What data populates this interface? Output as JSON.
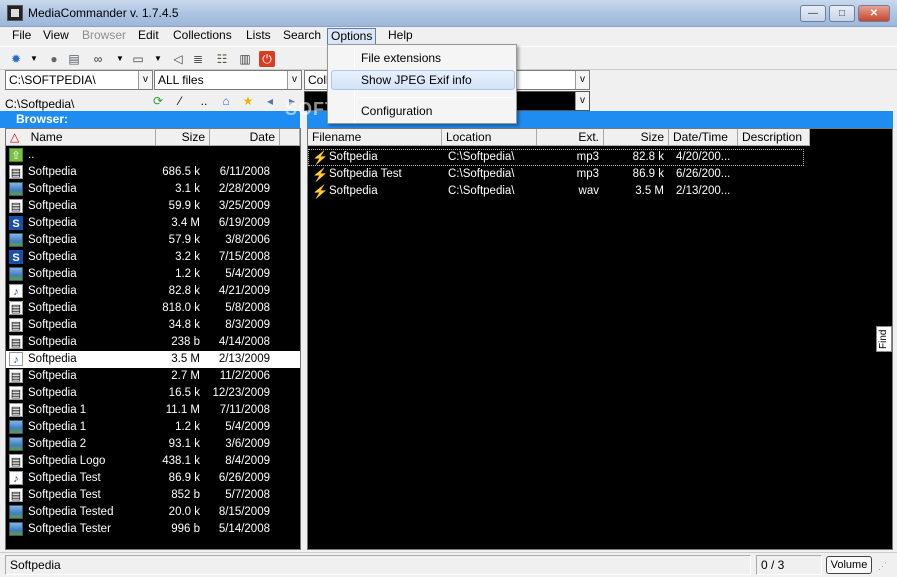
{
  "window": {
    "title": "MediaCommander v. 1.7.4.5",
    "controls": {
      "minimize": "—",
      "maximize": "□",
      "close": "✕"
    }
  },
  "menu": [
    {
      "label": "File",
      "state": "normal"
    },
    {
      "label": "View",
      "state": "normal"
    },
    {
      "label": "Browser",
      "state": "disabled"
    },
    {
      "label": "Edit",
      "state": "normal"
    },
    {
      "label": "Collections",
      "state": "normal"
    },
    {
      "label": "Lists",
      "state": "normal"
    },
    {
      "label": "Search",
      "state": "normal"
    },
    {
      "label": "Options",
      "state": "active"
    },
    {
      "label": "Help",
      "state": "normal"
    }
  ],
  "options_menu": {
    "items": [
      {
        "label": "File extensions"
      },
      {
        "label": "Show JPEG Exif info",
        "highlighted": true
      },
      {
        "label": "Configuration"
      }
    ]
  },
  "toolbar": {
    "icons": [
      "settings-icon",
      "globe-icon",
      "db-icon",
      "binoculars-icon",
      "window-icon",
      "fish-icon",
      "tree-icon",
      "book-icon",
      "power-icon"
    ]
  },
  "left": {
    "drive_combo": "C:\\SOFTPEDIA\\",
    "filter_combo": "ALL files",
    "path": "C:\\Softpedia\\",
    "nav_icons": {
      "refresh": "⟳",
      "sort": "⁄",
      "up": "..",
      "home": "⌂",
      "favorite": "★"
    },
    "panel_title": "Browser:",
    "columns": {
      "sort_indicator": "△",
      "name": "Name",
      "size": "Size",
      "date": "Date"
    },
    "rows": [
      {
        "icon": "up",
        "name": "..",
        "size": "",
        "date": ""
      },
      {
        "icon": "doc",
        "name": "Softpedia",
        "size": "686.5 k",
        "date": "6/11/2008"
      },
      {
        "icon": "img",
        "name": "Softpedia",
        "size": "3.1 k",
        "date": "2/28/2009"
      },
      {
        "icon": "doc",
        "name": "Softpedia",
        "size": "59.9 k",
        "date": "3/25/2009"
      },
      {
        "icon": "blue",
        "name": "Softpedia",
        "size": "3.4 M",
        "date": "6/19/2009"
      },
      {
        "icon": "img",
        "name": "Softpedia",
        "size": "57.9 k",
        "date": "3/8/2006"
      },
      {
        "icon": "blue",
        "name": "Softpedia",
        "size": "3.2 k",
        "date": "7/15/2008"
      },
      {
        "icon": "img",
        "name": "Softpedia",
        "size": "1.2 k",
        "date": "5/4/2009"
      },
      {
        "icon": "music",
        "name": "Softpedia",
        "size": "82.8 k",
        "date": "4/21/2009"
      },
      {
        "icon": "doc",
        "name": "Softpedia",
        "size": "818.0 k",
        "date": "5/8/2008"
      },
      {
        "icon": "doc",
        "name": "Softpedia",
        "size": "34.8 k",
        "date": "8/3/2009"
      },
      {
        "icon": "doc",
        "name": "Softpedia",
        "size": "238 b",
        "date": "4/14/2008"
      },
      {
        "icon": "music",
        "name": "Softpedia",
        "size": "3.5 M",
        "date": "2/13/2009",
        "selected": true
      },
      {
        "icon": "doc",
        "name": "Softpedia",
        "size": "2.7 M",
        "date": "11/2/2006"
      },
      {
        "icon": "doc",
        "name": "Softpedia",
        "size": "16.5 k",
        "date": "12/23/2009"
      },
      {
        "icon": "doc",
        "name": "Softpedia 1",
        "size": "11.1 M",
        "date": "7/11/2008"
      },
      {
        "icon": "img",
        "name": "Softpedia 1",
        "size": "1.2 k",
        "date": "5/4/2009"
      },
      {
        "icon": "img",
        "name": "Softpedia 2",
        "size": "93.1 k",
        "date": "3/6/2009"
      },
      {
        "icon": "doc",
        "name": "Softpedia Logo",
        "size": "438.1 k",
        "date": "8/4/2009"
      },
      {
        "icon": "music",
        "name": "Softpedia Test",
        "size": "86.9 k",
        "date": "6/26/2009"
      },
      {
        "icon": "doc",
        "name": "Softpedia Test",
        "size": "852 b",
        "date": "5/7/2008"
      },
      {
        "icon": "img",
        "name": "Softpedia Tested",
        "size": "20.0 k",
        "date": "8/15/2009"
      },
      {
        "icon": "img",
        "name": "Softpedia Tester",
        "size": "996 b",
        "date": "5/14/2008"
      }
    ]
  },
  "right": {
    "collection_combo": "Colle",
    "combo_arrow": "v",
    "columns": {
      "filename": "Filename",
      "location": "Location",
      "ext": "Ext.",
      "size": "Size",
      "datetime": "Date/Time",
      "description": "Description"
    },
    "rows": [
      {
        "filename": "Softpedia",
        "location": "C:\\Softpedia\\",
        "ext": "mp3",
        "size": "82.8 k",
        "datetime": "4/20/200..."
      },
      {
        "filename": "Softpedia Test",
        "location": "C:\\Softpedia\\",
        "ext": "mp3",
        "size": "86.9 k",
        "datetime": "6/26/200..."
      },
      {
        "filename": "Softpedia",
        "location": "C:\\Softpedia\\",
        "ext": "wav",
        "size": "3.5 M",
        "datetime": "2/13/200..."
      }
    ],
    "find_tab": "Find"
  },
  "status": {
    "current": "Softpedia",
    "counter": "0 / 3",
    "volume_button": "Volume"
  },
  "watermark": "SOFTPEDIA"
}
